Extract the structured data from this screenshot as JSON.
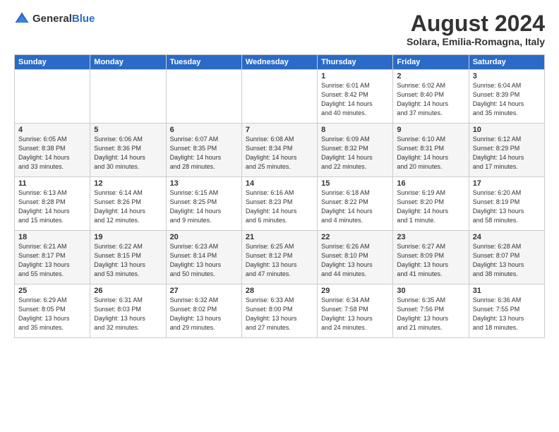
{
  "header": {
    "logo": {
      "general": "General",
      "blue": "Blue"
    },
    "title": "August 2024",
    "location": "Solara, Emilia-Romagna, Italy"
  },
  "days_of_week": [
    "Sunday",
    "Monday",
    "Tuesday",
    "Wednesday",
    "Thursday",
    "Friday",
    "Saturday"
  ],
  "weeks": [
    [
      {
        "day": "",
        "info": ""
      },
      {
        "day": "",
        "info": ""
      },
      {
        "day": "",
        "info": ""
      },
      {
        "day": "",
        "info": ""
      },
      {
        "day": "1",
        "info": "Sunrise: 6:01 AM\nSunset: 8:42 PM\nDaylight: 14 hours\nand 40 minutes."
      },
      {
        "day": "2",
        "info": "Sunrise: 6:02 AM\nSunset: 8:40 PM\nDaylight: 14 hours\nand 37 minutes."
      },
      {
        "day": "3",
        "info": "Sunrise: 6:04 AM\nSunset: 8:39 PM\nDaylight: 14 hours\nand 35 minutes."
      }
    ],
    [
      {
        "day": "4",
        "info": "Sunrise: 6:05 AM\nSunset: 8:38 PM\nDaylight: 14 hours\nand 33 minutes."
      },
      {
        "day": "5",
        "info": "Sunrise: 6:06 AM\nSunset: 8:36 PM\nDaylight: 14 hours\nand 30 minutes."
      },
      {
        "day": "6",
        "info": "Sunrise: 6:07 AM\nSunset: 8:35 PM\nDaylight: 14 hours\nand 28 minutes."
      },
      {
        "day": "7",
        "info": "Sunrise: 6:08 AM\nSunset: 8:34 PM\nDaylight: 14 hours\nand 25 minutes."
      },
      {
        "day": "8",
        "info": "Sunrise: 6:09 AM\nSunset: 8:32 PM\nDaylight: 14 hours\nand 22 minutes."
      },
      {
        "day": "9",
        "info": "Sunrise: 6:10 AM\nSunset: 8:31 PM\nDaylight: 14 hours\nand 20 minutes."
      },
      {
        "day": "10",
        "info": "Sunrise: 6:12 AM\nSunset: 8:29 PM\nDaylight: 14 hours\nand 17 minutes."
      }
    ],
    [
      {
        "day": "11",
        "info": "Sunrise: 6:13 AM\nSunset: 8:28 PM\nDaylight: 14 hours\nand 15 minutes."
      },
      {
        "day": "12",
        "info": "Sunrise: 6:14 AM\nSunset: 8:26 PM\nDaylight: 14 hours\nand 12 minutes."
      },
      {
        "day": "13",
        "info": "Sunrise: 6:15 AM\nSunset: 8:25 PM\nDaylight: 14 hours\nand 9 minutes."
      },
      {
        "day": "14",
        "info": "Sunrise: 6:16 AM\nSunset: 8:23 PM\nDaylight: 14 hours\nand 6 minutes."
      },
      {
        "day": "15",
        "info": "Sunrise: 6:18 AM\nSunset: 8:22 PM\nDaylight: 14 hours\nand 4 minutes."
      },
      {
        "day": "16",
        "info": "Sunrise: 6:19 AM\nSunset: 8:20 PM\nDaylight: 14 hours\nand 1 minute."
      },
      {
        "day": "17",
        "info": "Sunrise: 6:20 AM\nSunset: 8:19 PM\nDaylight: 13 hours\nand 58 minutes."
      }
    ],
    [
      {
        "day": "18",
        "info": "Sunrise: 6:21 AM\nSunset: 8:17 PM\nDaylight: 13 hours\nand 55 minutes."
      },
      {
        "day": "19",
        "info": "Sunrise: 6:22 AM\nSunset: 8:15 PM\nDaylight: 13 hours\nand 53 minutes."
      },
      {
        "day": "20",
        "info": "Sunrise: 6:23 AM\nSunset: 8:14 PM\nDaylight: 13 hours\nand 50 minutes."
      },
      {
        "day": "21",
        "info": "Sunrise: 6:25 AM\nSunset: 8:12 PM\nDaylight: 13 hours\nand 47 minutes."
      },
      {
        "day": "22",
        "info": "Sunrise: 6:26 AM\nSunset: 8:10 PM\nDaylight: 13 hours\nand 44 minutes."
      },
      {
        "day": "23",
        "info": "Sunrise: 6:27 AM\nSunset: 8:09 PM\nDaylight: 13 hours\nand 41 minutes."
      },
      {
        "day": "24",
        "info": "Sunrise: 6:28 AM\nSunset: 8:07 PM\nDaylight: 13 hours\nand 38 minutes."
      }
    ],
    [
      {
        "day": "25",
        "info": "Sunrise: 6:29 AM\nSunset: 8:05 PM\nDaylight: 13 hours\nand 35 minutes."
      },
      {
        "day": "26",
        "info": "Sunrise: 6:31 AM\nSunset: 8:03 PM\nDaylight: 13 hours\nand 32 minutes."
      },
      {
        "day": "27",
        "info": "Sunrise: 6:32 AM\nSunset: 8:02 PM\nDaylight: 13 hours\nand 29 minutes."
      },
      {
        "day": "28",
        "info": "Sunrise: 6:33 AM\nSunset: 8:00 PM\nDaylight: 13 hours\nand 27 minutes."
      },
      {
        "day": "29",
        "info": "Sunrise: 6:34 AM\nSunset: 7:58 PM\nDaylight: 13 hours\nand 24 minutes."
      },
      {
        "day": "30",
        "info": "Sunrise: 6:35 AM\nSunset: 7:56 PM\nDaylight: 13 hours\nand 21 minutes."
      },
      {
        "day": "31",
        "info": "Sunrise: 6:36 AM\nSunset: 7:55 PM\nDaylight: 13 hours\nand 18 minutes."
      }
    ]
  ]
}
